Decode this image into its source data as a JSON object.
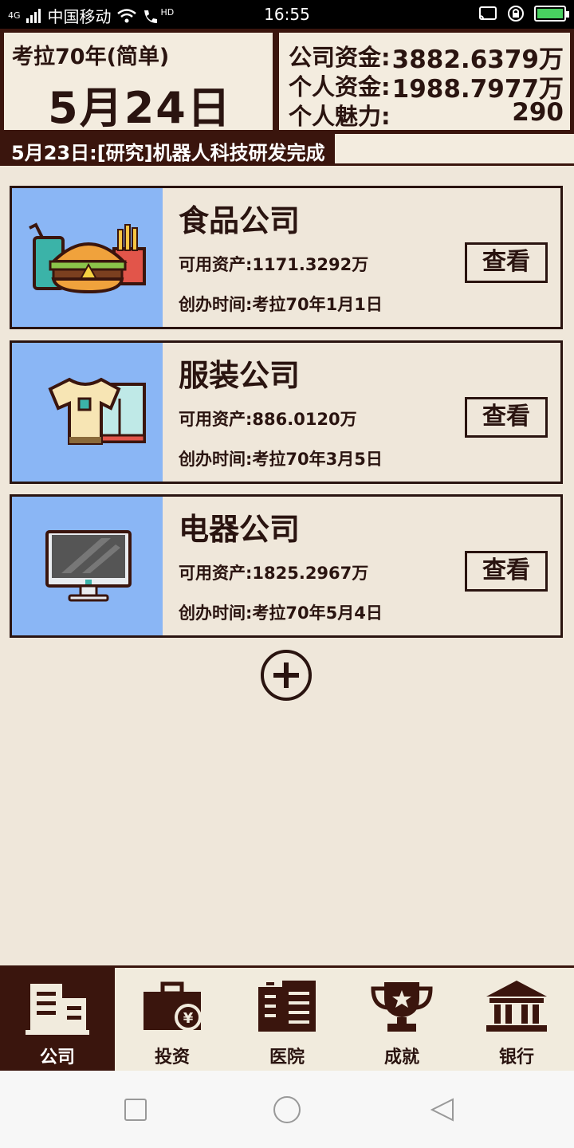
{
  "status_bar": {
    "network": "4G",
    "carrier": "中国移动",
    "hd": "HD",
    "time": "16:55",
    "battery_level": 0.9
  },
  "header": {
    "year_label": "考拉70年(简单)",
    "date": "5月24日",
    "company_funds_label": "公司资金:",
    "company_funds_value": "3882.6379万",
    "personal_funds_label": "个人资金:",
    "personal_funds_value": "1988.7977万",
    "charm_label": "个人魅力:",
    "charm_value": "290"
  },
  "ticker": {
    "text": "5月23日:[研究]机器人科技研发完成"
  },
  "companies": [
    {
      "name": "食品公司",
      "assets": "可用资产:1171.3292万",
      "founded": "创办时间:考拉70年1月1日",
      "button": "查看",
      "icon": "food-icon"
    },
    {
      "name": "服装公司",
      "assets": "可用资产:886.0120万",
      "founded": "创办时间:考拉70年3月5日",
      "button": "查看",
      "icon": "clothing-icon"
    },
    {
      "name": "电器公司",
      "assets": "可用资产:1825.2967万",
      "founded": "创办时间:考拉70年5月4日",
      "button": "查看",
      "icon": "monitor-icon"
    }
  ],
  "bottom_nav": [
    {
      "label": "公司",
      "icon": "office-building-icon",
      "active": true
    },
    {
      "label": "投资",
      "icon": "briefcase-yen-icon",
      "active": false
    },
    {
      "label": "医院",
      "icon": "hospital-icon",
      "active": false
    },
    {
      "label": "成就",
      "icon": "trophy-icon",
      "active": false
    },
    {
      "label": "银行",
      "icon": "bank-icon",
      "active": false
    }
  ],
  "colors": {
    "background": "#efe7da",
    "dark_brown": "#3a150d",
    "thumb_blue": "#8ab6f5"
  }
}
